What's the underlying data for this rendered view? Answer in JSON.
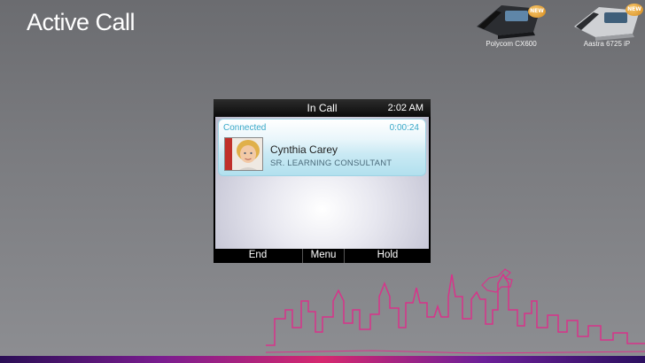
{
  "slide": {
    "title": "Active Call"
  },
  "products": [
    {
      "name": "Polycom CX600",
      "badge": "NEW"
    },
    {
      "name": "Aastra 6725 iP",
      "badge": "NEW"
    }
  ],
  "device": {
    "status_title": "In Call",
    "clock": "2:02 AM",
    "call": {
      "status": "Connected",
      "duration": "0:00:24",
      "caller_name": "Cynthia Carey",
      "caller_title": "SR. LEARNING CONSULTANT"
    },
    "softkeys": [
      "End",
      "Menu",
      "Hold"
    ]
  },
  "colors": {
    "accent_call": "#3aa8c8",
    "skyline": "#d8338a",
    "background": "#7a7b7f"
  }
}
